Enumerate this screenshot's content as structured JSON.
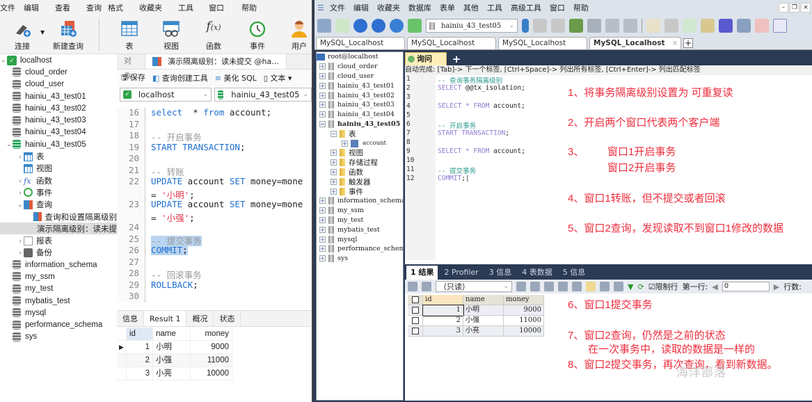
{
  "navicat": {
    "menu": [
      "文件",
      "编辑",
      "查看",
      "查询",
      "格式",
      "收藏夹",
      "工具",
      "窗口",
      "帮助"
    ],
    "toolbar": [
      {
        "label": "连接",
        "icon": "connect-icon"
      },
      {
        "label": "新建查询",
        "icon": "new-query-icon"
      },
      {
        "label": "表",
        "icon": "table-icon"
      },
      {
        "label": "视图",
        "icon": "view-icon"
      },
      {
        "label": "函数",
        "icon": "function-icon"
      },
      {
        "label": "事件",
        "icon": "event-icon"
      },
      {
        "label": "用户",
        "icon": "user-icon"
      }
    ],
    "tree": {
      "connection": "localhost",
      "databases_top": [
        "cloud_order",
        "cloud_user",
        "hainiu_43_test01",
        "hainiu_43_test02",
        "hainiu_43_test03",
        "hainiu_43_test04"
      ],
      "open_db": "hainiu_43_test05",
      "children": [
        "表",
        "视图",
        "函数",
        "事件",
        "查询"
      ],
      "queries": [
        "查询和设置隔离级别",
        "演示隔离级别：读未提"
      ],
      "more_children": [
        "报表",
        "备份"
      ],
      "databases_bottom": [
        "information_schema",
        "my_ssm",
        "my_test",
        "mybatis_test",
        "mysql",
        "performance_schema",
        "sys"
      ]
    },
    "tabs": {
      "objects": "对象",
      "active": "演示隔离级别：读未提交 @ha..."
    },
    "query_toolbar": {
      "save": "保存",
      "builder": "查询创建工具",
      "beautify": "美化 SQL",
      "text": "文本"
    },
    "connection_select": "localhost",
    "database_select": "hainiu_43_test05",
    "code_lines": [
      {
        "n": "16",
        "parts": [
          [
            "kw",
            "select"
          ],
          [
            "",
            "  * "
          ],
          [
            "kw",
            "from"
          ],
          [
            "",
            " account;"
          ]
        ]
      },
      {
        "n": "17",
        "parts": []
      },
      {
        "n": "18",
        "parts": [
          [
            "cm",
            "-- 开启事务"
          ]
        ]
      },
      {
        "n": "19",
        "parts": [
          [
            "kw",
            "START TRANSACTION"
          ],
          [
            "",
            ";"
          ]
        ]
      },
      {
        "n": "20",
        "parts": []
      },
      {
        "n": "21",
        "parts": [
          [
            "cm",
            "-- 转账"
          ]
        ]
      },
      {
        "n": "22",
        "parts": [
          [
            "kw",
            "UPDATE"
          ],
          [
            "",
            " account "
          ],
          [
            "kw",
            "SET"
          ],
          [
            "",
            " money=mone"
          ]
        ]
      },
      {
        "n": "",
        "parts": [
          [
            "",
            "= "
          ],
          [
            "st",
            "'小明'"
          ],
          [
            "",
            ";"
          ]
        ]
      },
      {
        "n": "23",
        "parts": [
          [
            "kw",
            "UPDATE"
          ],
          [
            "",
            " account "
          ],
          [
            "kw",
            "SET"
          ],
          [
            "",
            " money=mone"
          ]
        ]
      },
      {
        "n": "",
        "parts": [
          [
            "",
            "= "
          ],
          [
            "st",
            "'小强'"
          ],
          [
            "",
            ";"
          ]
        ]
      },
      {
        "n": "24",
        "parts": []
      },
      {
        "n": "25",
        "parts": [
          [
            "cm hl",
            "-- 提交事务"
          ]
        ]
      },
      {
        "n": "26",
        "parts": [
          [
            "kw hl",
            "COMMIT"
          ],
          [
            "hl",
            ";"
          ]
        ]
      },
      {
        "n": "27",
        "parts": []
      },
      {
        "n": "28",
        "parts": [
          [
            "cm",
            "-- 回滚事务"
          ]
        ]
      },
      {
        "n": "29",
        "parts": [
          [
            "kw",
            "ROLLBACK"
          ],
          [
            "",
            ";"
          ]
        ]
      },
      {
        "n": "30",
        "parts": []
      }
    ],
    "result_tabs": [
      "信息",
      "Result 1",
      "概况",
      "状态"
    ],
    "result_columns": [
      "id",
      "name",
      "money"
    ],
    "result_rows": [
      [
        "1",
        "小明",
        "9000"
      ],
      [
        "2",
        "小强",
        "11000"
      ],
      [
        "3",
        "小亮",
        "10000"
      ]
    ]
  },
  "sqlyog": {
    "menu": [
      "文件",
      "编辑",
      "收藏夹",
      "数据库",
      "表单",
      "其他",
      "工具",
      "高级工具",
      "窗口",
      "帮助"
    ],
    "db_select": "hainiu_43_test05",
    "connection_tabs": [
      "MySQL_Localhost",
      "MySQL_Localhost",
      "MySQL_Localhost",
      "MySQL_Localhost"
    ],
    "tree": {
      "root": "root@localhost",
      "dbs_top": [
        "cloud_order",
        "cloud_user",
        "hainiu_43_test01",
        "hainiu_43_test02",
        "hainiu_43_test03",
        "hainiu_43_test04"
      ],
      "open_db": "hainiu_43_test05",
      "folders": [
        "表",
        "视图",
        "存储过程",
        "函数",
        "触发器",
        "事件"
      ],
      "table": "account",
      "dbs_bottom": [
        "information_schema",
        "my_ssm",
        "my_test",
        "mybatis_test",
        "mysql",
        "performance_schema",
        "sys"
      ]
    },
    "query_tab": "询问",
    "hint": "自动完成: [Tab]-> 下一个标签, [Ctrl+Space]-> 列出所有标签, [Ctrl+Enter]-> 列出匹配标签",
    "code_lines": [
      {
        "n": "1",
        "parts": [
          [
            "ycm",
            "-- 查询事务隔离级别"
          ]
        ]
      },
      {
        "n": "2",
        "parts": [
          [
            "ykw",
            "SELECT"
          ],
          [
            "",
            " @@tx_isolation;"
          ]
        ]
      },
      {
        "n": "3",
        "parts": []
      },
      {
        "n": "4",
        "parts": [
          [
            "ykw",
            "SELECT * FROM"
          ],
          [
            "",
            " account;"
          ]
        ]
      },
      {
        "n": "5",
        "parts": []
      },
      {
        "n": "6",
        "parts": [
          [
            "ycm",
            "-- 开启事务"
          ]
        ]
      },
      {
        "n": "7",
        "parts": [
          [
            "ykw",
            "START TRANSACTION"
          ],
          [
            "",
            ";"
          ]
        ]
      },
      {
        "n": "8",
        "parts": []
      },
      {
        "n": "9",
        "parts": [
          [
            "ykw",
            "SELECT * FROM"
          ],
          [
            "",
            " account;"
          ]
        ]
      },
      {
        "n": "10",
        "parts": []
      },
      {
        "n": "11",
        "parts": [
          [
            "ycm",
            "-- 提交事务"
          ]
        ]
      },
      {
        "n": "12",
        "parts": [
          [
            "ykw",
            "COMMIT"
          ],
          [
            "",
            ";|"
          ]
        ]
      }
    ],
    "result_tabs": [
      "1 结果",
      "2 Profiler",
      "3 信息",
      "4 表数据",
      "5 信息"
    ],
    "readonly_select": "（只读）",
    "limit_rows_label": "限制行",
    "first_row_label": "第一行:",
    "first_row_value": "0",
    "row_count_label": "行数:",
    "result_columns": [
      "id",
      "name",
      "money"
    ],
    "result_rows": [
      [
        "1",
        "小明",
        "9000"
      ],
      [
        "2",
        "小强",
        "11000"
      ],
      [
        "3",
        "小亮",
        "10000"
      ]
    ]
  },
  "annotations": [
    "1、将事务隔离级别设置为 可重复读",
    "2、开启两个窗口代表两个客户端",
    "3、",
    "窗口1开启事务",
    "窗口2开启事务",
    "4、窗口1转账，但不提交或者回滚",
    "5、窗口2查询，发现读取不到窗口1修改的数据",
    "6、窗口1提交事务",
    "7、窗口2查询，仍然是之前的状态",
    "在一次事务中，读取的数据是一样的",
    "8、窗口2提交事务，再次查询，看到新数据。"
  ],
  "watermark": "海洋部落",
  "colors": {
    "annotation": "#ee2d3d",
    "keyword": "#1e6fd0",
    "sqlyog_bg": "#2b3a55"
  }
}
